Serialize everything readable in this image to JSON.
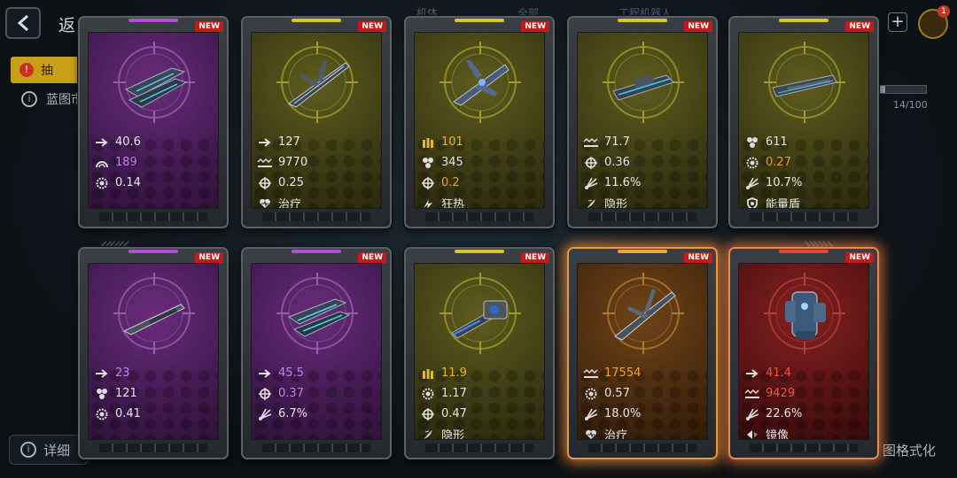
{
  "header": {
    "back_title": "返",
    "tabs": [
      "机体",
      "全部",
      "工程机器人"
    ],
    "cart_count": "1"
  },
  "warning_tab": {
    "label": "抽"
  },
  "info": {
    "text": "蓝图市"
  },
  "progress": {
    "text": "14/100",
    "fraction": 0.14
  },
  "footer": {
    "details_label": "详细",
    "format_label": "图格式化"
  },
  "colors": {
    "purple": "#c184e6",
    "gold": "#e9b52a",
    "red": "#f0553f",
    "orange": "#f0a030",
    "white": "#e6e6e6"
  },
  "cards": [
    {
      "new": "NEW",
      "rarity": "purple",
      "stats": [
        {
          "icon": "arrow-icon",
          "value": "40.6",
          "color": "white"
        },
        {
          "icon": "dome-icon",
          "value": "189",
          "color": "purple"
        },
        {
          "icon": "gear-icon",
          "value": "0.14",
          "color": "white"
        }
      ]
    },
    {
      "new": "NEW",
      "rarity": "olive",
      "stats": [
        {
          "icon": "arrow-icon",
          "value": "127",
          "color": "white"
        },
        {
          "icon": "wave-icon",
          "value": "9770",
          "color": "white"
        },
        {
          "icon": "crosshair-icon",
          "value": "0.25",
          "color": "white"
        },
        {
          "icon": "heart-icon",
          "value": "治疗",
          "color": "white"
        }
      ]
    },
    {
      "new": "NEW",
      "rarity": "olive",
      "stats": [
        {
          "icon": "ammo-icon",
          "value": "101",
          "color": "gold"
        },
        {
          "icon": "cluster-icon",
          "value": "345",
          "color": "white"
        },
        {
          "icon": "crosshair-icon",
          "value": "0.2",
          "color": "orange"
        },
        {
          "icon": "frenzy-icon",
          "value": "狂热",
          "color": "white"
        }
      ]
    },
    {
      "new": "NEW",
      "rarity": "olive",
      "stats": [
        {
          "icon": "wave-icon",
          "value": "71.7",
          "color": "white"
        },
        {
          "icon": "crosshair-icon",
          "value": "0.36",
          "color": "white"
        },
        {
          "icon": "spread-icon",
          "value": "11.6%",
          "color": "white"
        },
        {
          "icon": "stealth-icon",
          "value": "隐形",
          "color": "white"
        }
      ]
    },
    {
      "new": "NEW",
      "rarity": "olive",
      "stats": [
        {
          "icon": "cluster-icon",
          "value": "611",
          "color": "white"
        },
        {
          "icon": "gear-icon",
          "value": "0.27",
          "color": "orange"
        },
        {
          "icon": "spread-icon",
          "value": "10.7%",
          "color": "white"
        },
        {
          "icon": "shield-icon",
          "value": "能量盾",
          "color": "white"
        }
      ]
    },
    {
      "new": "NEW",
      "rarity": "purple",
      "stats": [
        {
          "icon": "arrow-icon",
          "value": "23",
          "color": "purple"
        },
        {
          "icon": "cluster-icon",
          "value": "121",
          "color": "white"
        },
        {
          "icon": "gear-icon",
          "value": "0.41",
          "color": "white"
        }
      ]
    },
    {
      "new": "NEW",
      "rarity": "purple",
      "stats": [
        {
          "icon": "arrow-icon",
          "value": "45.5",
          "color": "purple"
        },
        {
          "icon": "crosshair-icon",
          "value": "0.37",
          "color": "purple"
        },
        {
          "icon": "spread-icon",
          "value": "6.7%",
          "color": "white"
        }
      ]
    },
    {
      "new": "NEW",
      "rarity": "olive",
      "stats": [
        {
          "icon": "ammo-icon",
          "value": "11.9",
          "color": "gold"
        },
        {
          "icon": "gear-icon",
          "value": "1.17",
          "color": "white"
        },
        {
          "icon": "crosshair-icon",
          "value": "0.47",
          "color": "white"
        },
        {
          "icon": "stealth-icon",
          "value": "隐形",
          "color": "white"
        }
      ]
    },
    {
      "new": "NEW",
      "rarity": "orange",
      "stats": [
        {
          "icon": "wave-icon",
          "value": "17554",
          "color": "orange"
        },
        {
          "icon": "gear-icon",
          "value": "0.57",
          "color": "white"
        },
        {
          "icon": "spread-icon",
          "value": "18.0%",
          "color": "white"
        },
        {
          "icon": "heart-icon",
          "value": "治疗",
          "color": "white"
        }
      ]
    },
    {
      "new": "NEW",
      "rarity": "red",
      "stats": [
        {
          "icon": "arrow-icon",
          "value": "41.4",
          "color": "red"
        },
        {
          "icon": "wave-icon",
          "value": "9429",
          "color": "red"
        },
        {
          "icon": "spread-icon",
          "value": "22.6%",
          "color": "white"
        },
        {
          "icon": "mirror-icon",
          "value": "镜像",
          "color": "white"
        }
      ]
    }
  ]
}
